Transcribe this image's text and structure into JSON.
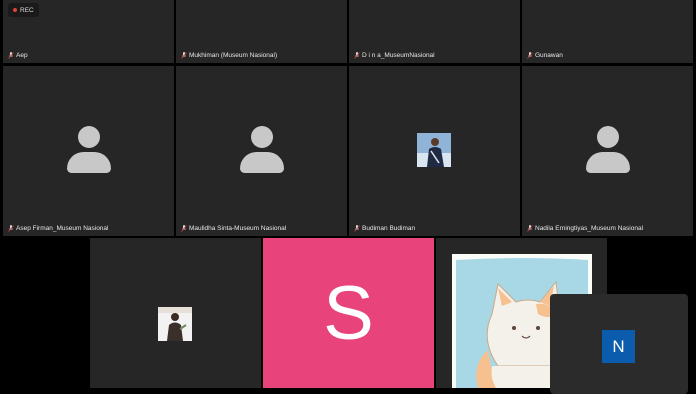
{
  "recording": {
    "label": "REC",
    "dot_color": "#e0413c"
  },
  "row1": [
    {
      "name": "Aep"
    },
    {
      "name": "Mukhiman (Museum Nasional)"
    },
    {
      "name": "D i n a_MuseumNasional"
    },
    {
      "name": "Gunawan"
    }
  ],
  "row2": [
    {
      "name": "Asep Firman_Museum Nasional"
    },
    {
      "name": "Maulidha Sinta-Museum Nasional"
    },
    {
      "name": "Budiman Budiman"
    },
    {
      "name": "Nadila Erningtiyas_Museum Nasional"
    }
  ],
  "row3": {
    "s_tile": {
      "letter": "S",
      "color": "#e8437a"
    }
  },
  "floating": {
    "letter": "N",
    "color": "#0b5cad"
  },
  "colors": {
    "tile_bg": "#262626",
    "avatar_gray": "#c8c8c8",
    "mic_icon": "#d9d9d9"
  }
}
